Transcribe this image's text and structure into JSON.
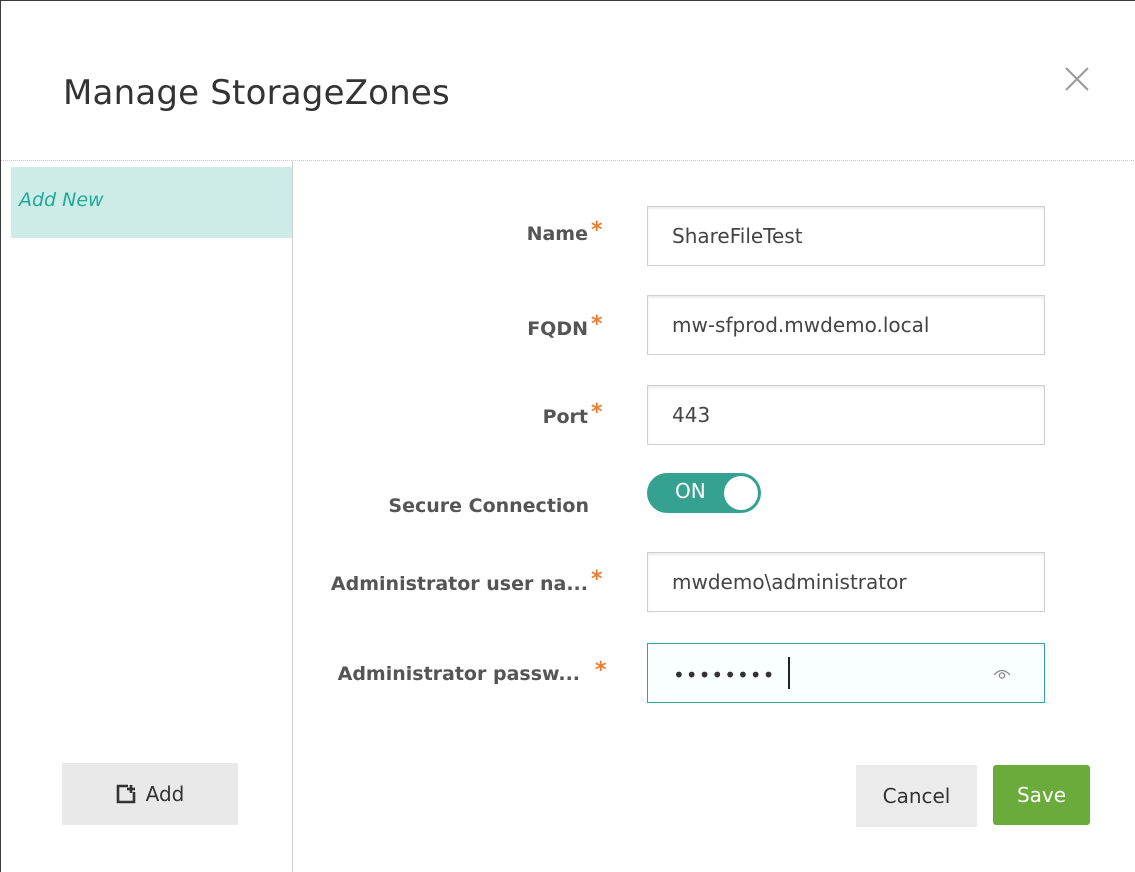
{
  "dialog": {
    "title": "Manage StorageZones",
    "close_icon": "close-icon"
  },
  "sidebar": {
    "items": [
      {
        "label": "Add New",
        "active": true
      }
    ],
    "add_button": {
      "icon": "add-item-icon",
      "label": "Add"
    }
  },
  "form": {
    "required_marker": "*",
    "name": {
      "label": "Name",
      "value": "ShareFileTest",
      "required": true
    },
    "fqdn": {
      "label": "FQDN",
      "value": "mw-sfprod.mwdemo.local",
      "required": true
    },
    "port": {
      "label": "Port",
      "value": "443",
      "required": true
    },
    "secure_connection": {
      "label": "Secure Connection",
      "state": "ON",
      "on": true
    },
    "admin_user": {
      "label": "Administrator user na...",
      "value": "mwdemo\\administrator",
      "required": true
    },
    "admin_password": {
      "label": "Administrator passw...",
      "masked_value": "••••••••",
      "required": true,
      "reveal_icon": "eye-icon"
    }
  },
  "footer": {
    "cancel_label": "Cancel",
    "save_label": "Save"
  },
  "colors": {
    "accent_teal": "#35a190",
    "required_orange": "#f07b2b",
    "save_green": "#6bab3c",
    "sidebar_active_bg": "#cdece8"
  }
}
